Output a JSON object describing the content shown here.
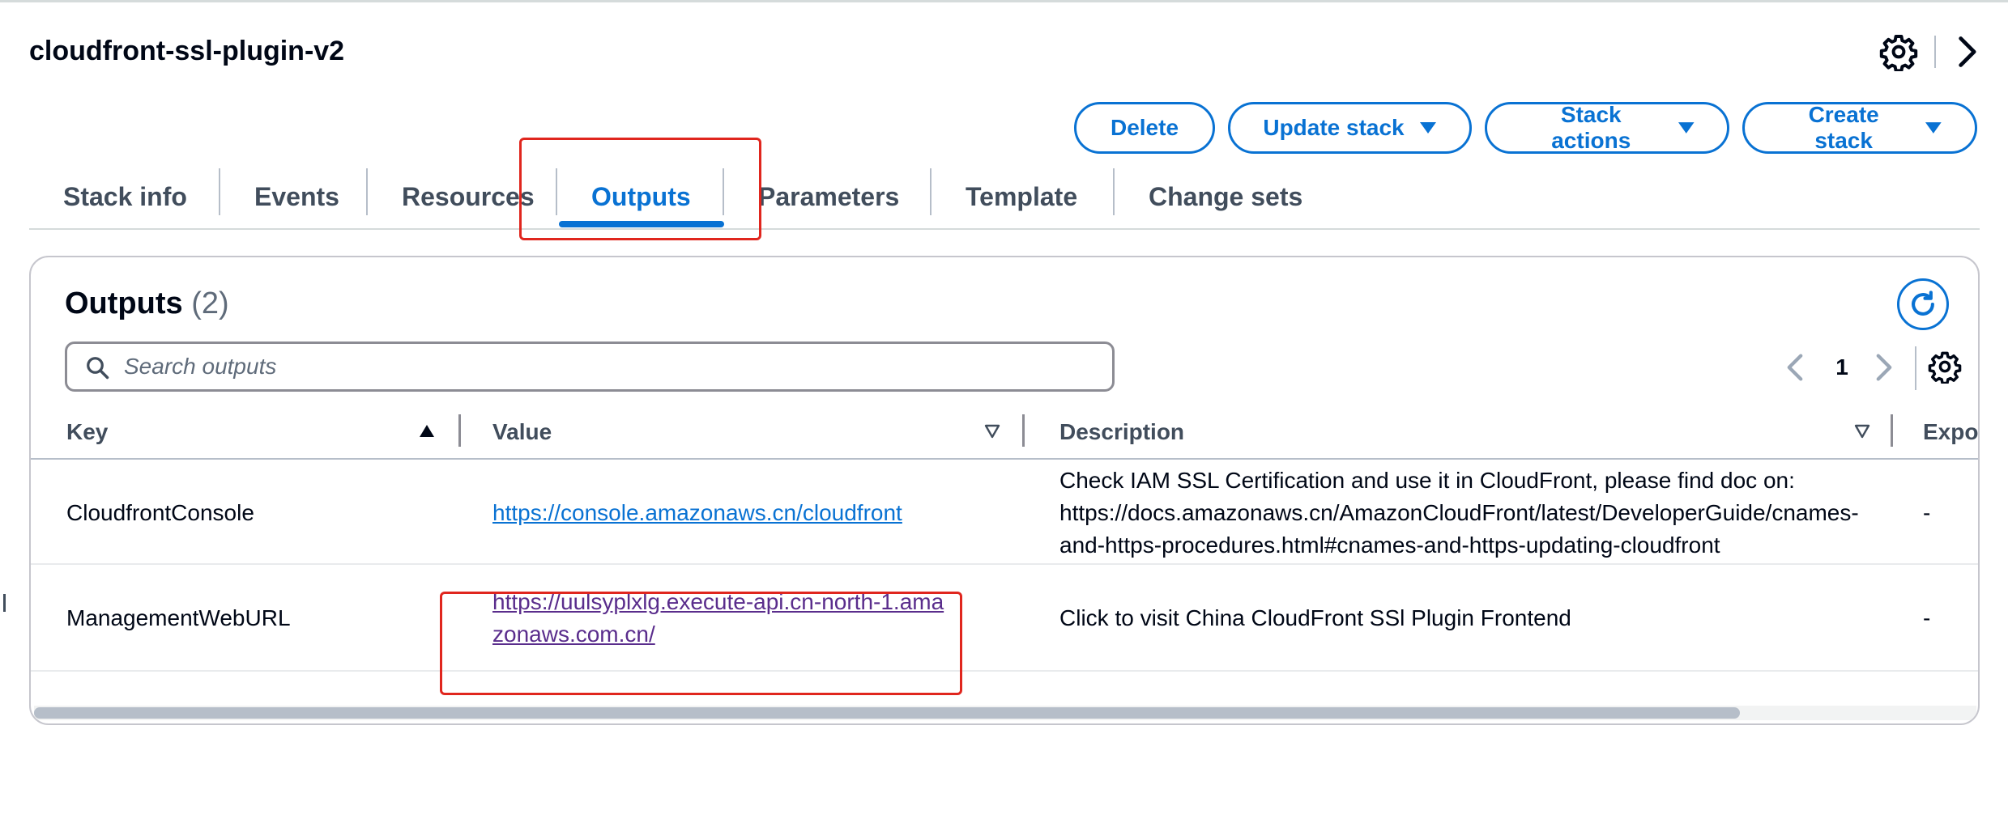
{
  "page": {
    "stack_name": "cloudfront-ssl-plugin-v2"
  },
  "header_icons": [
    "gear-icon",
    "chevron-right-icon"
  ],
  "actions": {
    "delete": "Delete",
    "update": "Update stack",
    "stack_actions": "Stack actions",
    "create": "Create stack"
  },
  "tabs": {
    "stack_info": "Stack info",
    "events": "Events",
    "resources": "Resources",
    "outputs": "Outputs",
    "parameters": "Parameters",
    "template": "Template",
    "change_sets": "Change sets",
    "active": "Outputs"
  },
  "outputs": {
    "title": "Outputs",
    "count": "(2)",
    "search_placeholder": "Search outputs",
    "search_value": "",
    "page_number": "1",
    "columns": {
      "key": "Key",
      "value": "Value",
      "description": "Description",
      "export": "Export name"
    },
    "rows": [
      {
        "key": "CloudfrontConsole",
        "value": "https://console.amazonaws.cn/cloudfront",
        "description": "Check IAM SSL Certification and use it in CloudFront, please find doc on: https://docs.amazonaws.cn/AmazonCloudFront/latest/DeveloperGuide/cnames-and-https-procedures.html#cnames-and-https-updating-cloudfront",
        "export": "-"
      },
      {
        "key": "ManagementWebURL",
        "value": "https://uulsyplxlg.execute-api.cn-north-1.amazonaws.com.cn/",
        "description": "Click to visit China CloudFront SSl Plugin Frontend",
        "export": "-"
      }
    ]
  },
  "colors": {
    "accent": "#0972d3",
    "visited_link": "#5a2d8c",
    "highlight_annotation": "#e0261e",
    "text": "#000716",
    "muted_text": "#414d5c"
  }
}
